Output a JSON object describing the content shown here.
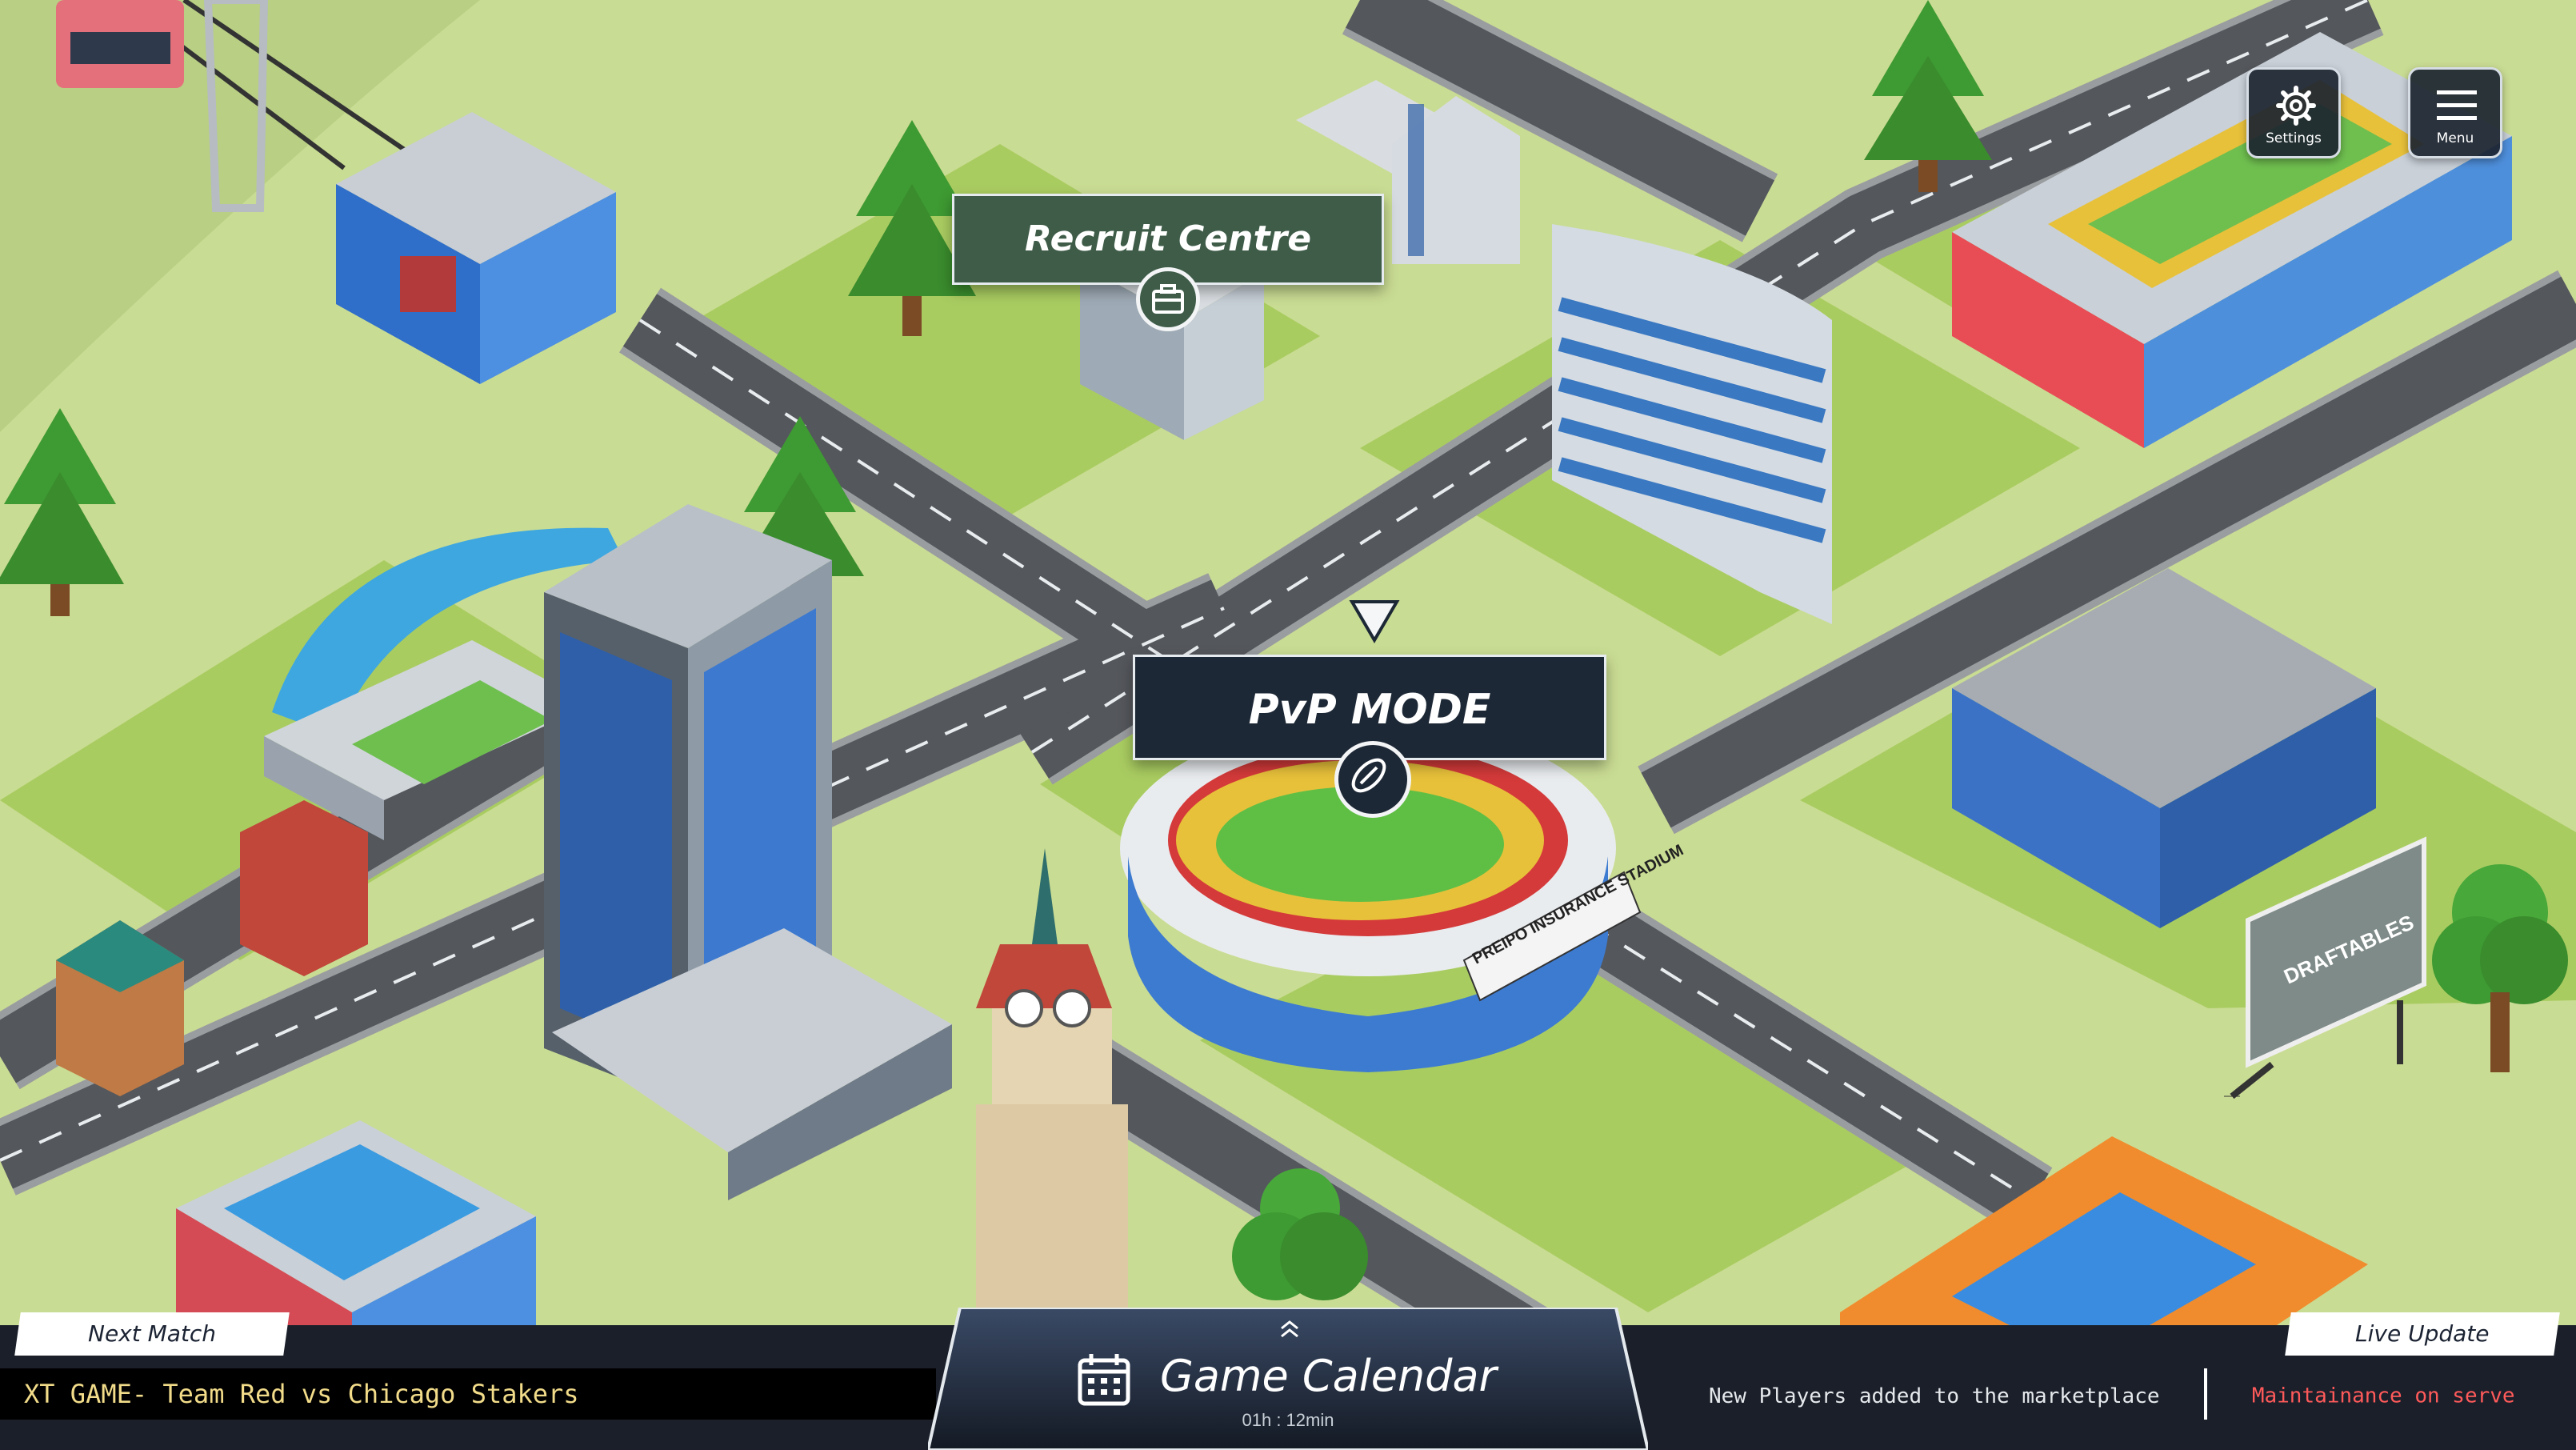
{
  "hud": {
    "settings_label": "Settings",
    "menu_label": "Menu"
  },
  "map": {
    "recruit_centre_label": "Recruit Centre",
    "pvp_label": "PvP MODE",
    "stadium_sign": "PREIPO INSURANCE STADIUM",
    "billboard_text": "DRAFTABLES"
  },
  "bottom": {
    "next_match_label": "Next Match",
    "next_match_ticker": "XT GAME- Team Red vs Chicago Stakers",
    "calendar_title": "Game Calendar",
    "calendar_timer": "01h : 12min",
    "live_update_label": "Live Update",
    "live_ticker_1": "New Players added to the marketplace",
    "live_ticker_2": "Maintainance on serve"
  },
  "colors": {
    "grass": "#c9dc93",
    "road": "#5a5c60",
    "dark_panel": "#1d2836",
    "recruit_panel": "#3e5c48",
    "ticker_green": "#f2dc8a",
    "ticker_red": "#ff5a5a"
  },
  "icons": {
    "settings": "gear-icon",
    "menu": "hamburger-icon",
    "recruit": "briefcase-icon",
    "pvp": "football-icon",
    "calendar": "calendar-icon",
    "expand": "chevron-up-icon"
  }
}
